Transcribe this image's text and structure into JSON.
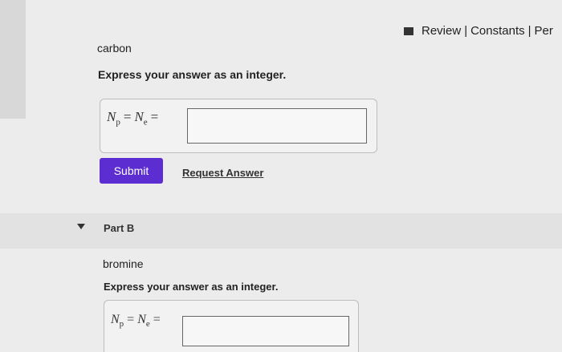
{
  "header": {
    "review_label": "Review",
    "constants_label": "Constants",
    "periodic_label": "Per",
    "separator": "|"
  },
  "part_a": {
    "element": "carbon",
    "prompt": "Express your answer as an integer.",
    "eq_np": "N",
    "eq_np_sub": "p",
    "eq_equals": "=",
    "eq_ne": "N",
    "eq_ne_sub": "e",
    "input_value": ""
  },
  "actions": {
    "submit_label": "Submit",
    "request_label": "Request Answer"
  },
  "part_b": {
    "title": "Part B",
    "element": "bromine",
    "prompt": "Express your answer as an integer.",
    "eq_np": "N",
    "eq_np_sub": "p",
    "eq_equals": "=",
    "eq_ne": "N",
    "eq_ne_sub": "e",
    "input_value": ""
  },
  "colors": {
    "submit_bg": "#5c2dd1",
    "page_bg": "#ececec"
  },
  "icons": {
    "book": "book-icon",
    "caret": "caret-down-icon"
  }
}
